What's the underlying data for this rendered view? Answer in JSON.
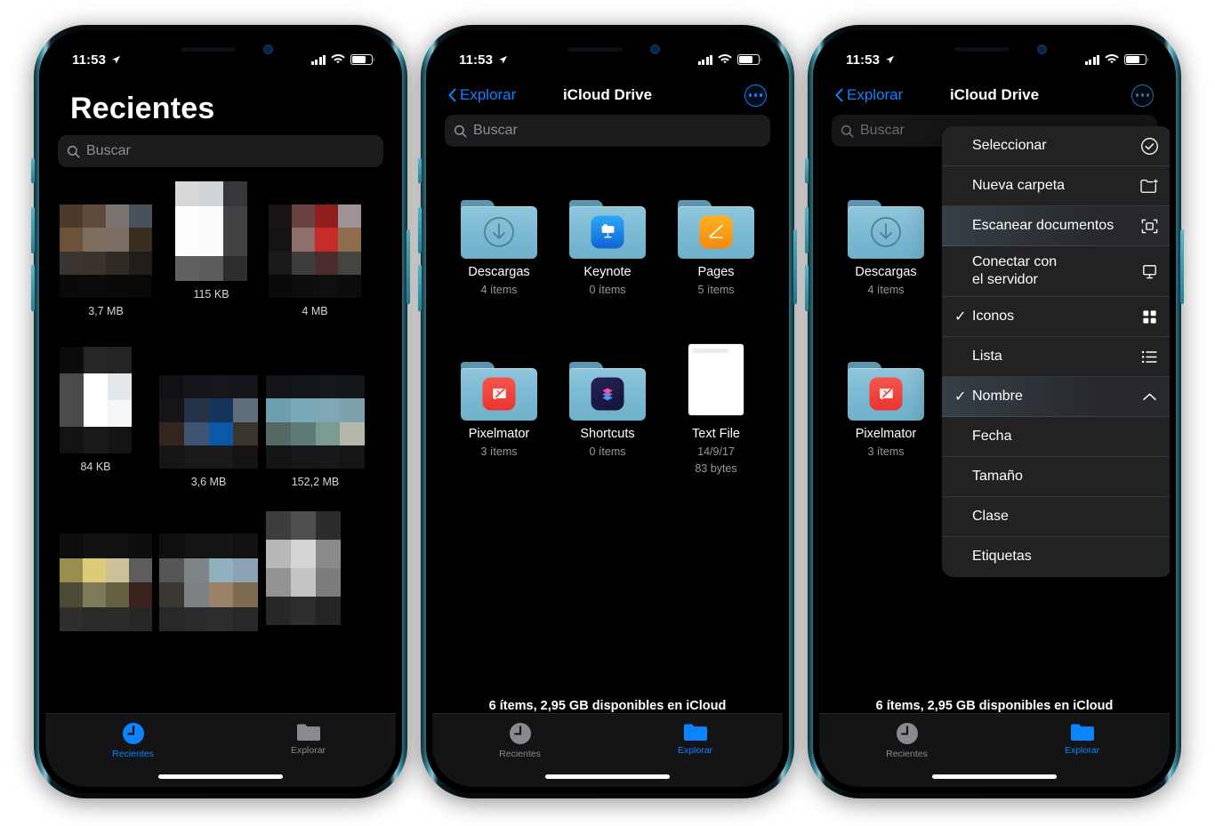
{
  "statusbar": {
    "time": "11:53",
    "location_icon": "location-arrow-icon",
    "signal_icon": "cellular-bars-icon",
    "wifi_icon": "wifi-icon",
    "battery_icon": "battery-icon"
  },
  "phone1": {
    "title": "Recientes",
    "search": {
      "placeholder": "Buscar",
      "icon": "search-icon"
    },
    "items": [
      {
        "size": "3,7 MB"
      },
      {
        "size": "115 KB"
      },
      {
        "size": "4 MB"
      },
      {
        "size": "84 KB"
      },
      {
        "size": "3,6 MB"
      },
      {
        "size": "152,2 MB"
      }
    ],
    "tabs": [
      {
        "label": "Recientes",
        "icon": "clock-icon",
        "active": true
      },
      {
        "label": "Explorar",
        "icon": "folder-icon",
        "active": false
      }
    ]
  },
  "phone2": {
    "nav": {
      "back_label": "Explorar",
      "title": "iCloud Drive",
      "more_icon": "ellipsis-circle-icon",
      "back_icon": "chevron-left-icon"
    },
    "search": {
      "placeholder": "Buscar",
      "icon": "search-icon"
    },
    "items": [
      {
        "name": "Descargas",
        "meta": "4 ítems",
        "icon": "downloads-folder-icon",
        "type": "folder"
      },
      {
        "name": "Keynote",
        "meta": "0 ítems",
        "icon": "keynote-app-icon",
        "type": "folder"
      },
      {
        "name": "Pages",
        "meta": "5 ítems",
        "icon": "pages-app-icon",
        "type": "folder"
      },
      {
        "name": "Pixelmator",
        "meta": "3 ítems",
        "icon": "pixelmator-app-icon",
        "type": "folder"
      },
      {
        "name": "Shortcuts",
        "meta": "0 ítems",
        "icon": "shortcuts-app-icon",
        "type": "folder"
      },
      {
        "name": "Text File",
        "meta": "14/9/17",
        "meta2": "83 bytes",
        "icon": "text-document-icon",
        "type": "document"
      }
    ],
    "status_line": "6 ítems, 2,95 GB disponibles en iCloud",
    "tabs": [
      {
        "label": "Recientes",
        "icon": "clock-icon",
        "active": false
      },
      {
        "label": "Explorar",
        "icon": "folder-icon",
        "active": true
      }
    ]
  },
  "phone3": {
    "nav": {
      "back_label": "Explorar",
      "title": "iCloud Drive",
      "more_icon": "ellipsis-circle-icon",
      "back_icon": "chevron-left-icon"
    },
    "search": {
      "placeholder": "Buscar",
      "icon": "search-icon"
    },
    "items": [
      {
        "name": "Descargas",
        "meta": "4 ítems",
        "icon": "downloads-folder-icon"
      },
      {
        "name": "Pixelmator",
        "meta": "3 ítems",
        "icon": "pixelmator-app-icon"
      }
    ],
    "menu": [
      {
        "label": "Seleccionar",
        "icon": "checkmark-circle-icon",
        "checked": false,
        "highlight": false
      },
      {
        "label": "Nueva carpeta",
        "icon": "folder-plus-icon",
        "checked": false,
        "highlight": false
      },
      {
        "label": "Escanear documentos",
        "icon": "scan-document-icon",
        "checked": false,
        "highlight": true
      },
      {
        "label": "Conectar con\nel servidor",
        "icon": "display-server-icon",
        "checked": false,
        "highlight": false,
        "tall": true
      },
      {
        "label": "Iconos",
        "icon": "grid-icon",
        "checked": true,
        "highlight": false
      },
      {
        "label": "Lista",
        "icon": "list-icon",
        "checked": false,
        "highlight": false
      },
      {
        "label": "Nombre",
        "icon": "chevron-up-icon",
        "checked": true,
        "highlight": true
      },
      {
        "label": "Fecha",
        "icon": "",
        "checked": false,
        "highlight": false
      },
      {
        "label": "Tamaño",
        "icon": "",
        "checked": false,
        "highlight": false
      },
      {
        "label": "Clase",
        "icon": "",
        "checked": false,
        "highlight": false
      },
      {
        "label": "Etiquetas",
        "icon": "",
        "checked": false,
        "highlight": false
      }
    ],
    "status_line": "6 ítems, 2,95 GB disponibles en iCloud",
    "tabs": [
      {
        "label": "Recientes",
        "icon": "clock-icon",
        "active": false
      },
      {
        "label": "Explorar",
        "icon": "folder-icon",
        "active": true
      }
    ]
  },
  "colors": {
    "accent_blue": "#0a84ff",
    "folder_blue": "#7ab9d2",
    "background": "#000000",
    "secondary_text": "#98989d",
    "frame_teal": "#3f8ea0"
  }
}
